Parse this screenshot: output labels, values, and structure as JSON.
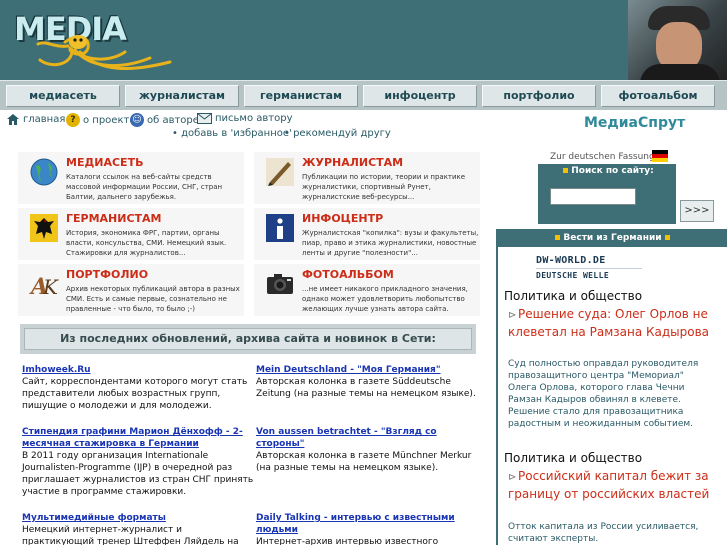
{
  "header": {
    "logo": "MEDIA"
  },
  "nav": [
    "медиасеть",
    "журналистам",
    "германистам",
    "инфоцентр",
    "портфолио",
    "фотоальбом"
  ],
  "toplinks": {
    "home": "главная",
    "about_project": "о проекте",
    "about_author": "об авторе",
    "letter": "письмо автору",
    "favorites": "• добавь в 'избранное'",
    "recommend": "• рекомендуй другу"
  },
  "site_title": "МедиаСпрут",
  "sections": [
    {
      "title": "МЕДИАСЕТЬ",
      "text": "Каталоги ссылок на веб-сайты средств массовой информации России, СНГ, стран Балтии, дальнего зарубежья.",
      "icon": "globe-icon"
    },
    {
      "title": "ЖУРНАЛИСТАМ",
      "text": "Публикации по истории, теории и практике журналистики, спортивный Рунет, журналистские веб-ресурсы...",
      "icon": "pen-icon"
    },
    {
      "title": "ГЕРМАНИСТАМ",
      "text": "История, экономика ФРГ, партии, органы власти, консульства, СМИ. Немецкий язык. Стажировки для журналистов...",
      "icon": "eagle-icon"
    },
    {
      "title": "ИНФОЦЕНТР",
      "text": "Журналистская \"копилка\": вузы и факультеты, пиар, право и этика журналистики, новостные ленты и другие \"полезности\"...",
      "icon": "info-icon"
    },
    {
      "title": "ПОРТФОЛИО",
      "text": "Архив некоторых публикаций автора в разных СМИ. Есть и самые первые, сознательно не правленные - что было, то было ;-)",
      "icon": "ak-monogram-icon"
    },
    {
      "title": "ФОТОАЛЬБОМ",
      "text": "...не имеет никакого прикладного значения, однако может удовлетворить любопытство желающих лучше узнать автора сайта.",
      "icon": "camera-icon"
    }
  ],
  "updates_header": "Из последних обновлений, архива сайта и новинок в Сети:",
  "news_left": [
    {
      "title": "Imhoweek.Ru",
      "text": "Сайт, корреспондентами которого могут стать представители любых возрастных групп, пишущие о молодежи и для молодежи."
    },
    {
      "title": "Стипендия графини Марион Дёнхофф - 2-месячная стажировка в Германии",
      "text": "В 2011 году организация Internationale Journalisten-Programme (IJP) в очередной раз приглашает журналистов из стран СНГ принять участие в программе стажировки."
    },
    {
      "title": "Мультимедийные форматы",
      "text": "Немецкий интернет-журналист и практикующий тренер Штеффен Ляйдель на примерах из мира СМИ"
    }
  ],
  "news_right": [
    {
      "title": "Mein Deutschland - \"Моя Германия\"",
      "text": "Авторская колонка в газете Süddeutsche Zeitung (на разные темы на немецком языке)."
    },
    {
      "title": "Von aussen betrachtet - \"Взгляд со стороны\"",
      "text": "Авторская колонка в газете Münchner Merkur (на разные темы на немецком языке)."
    },
    {
      "title": "Daily Talking - интервью с известными людьми",
      "text": "Интернет-архив интервью известного российского журналиста Андрея Морозова."
    }
  ],
  "right": {
    "lang_link": "Zur deutschen Fassung",
    "search_label": "Поиск по сайту:",
    "search_value": "",
    "search_button": ">>>",
    "dw_header": "Вести из Германии",
    "dw_logo_line1": "DW-WORLD.DE",
    "dw_logo_line2": "DEUTSCHE WELLE",
    "sections": [
      {
        "title": "Политика и общество",
        "item": "Решение суда: Олег Орлов не клеветал на Рамзана Кадырова",
        "desc": "Суд полностью оправдал руководителя правозащитного центра \"Мемориал\" Олега Орлова, которого глава Чечни Рамзан Кадыров обвинял в клевете. Решение стало для правозащитника радостным и неожиданным событием."
      },
      {
        "title": "Политика и общество",
        "item": "Российский капитал бежит за границу от российских властей",
        "desc": "Отток капитала из России усиливается, считают эксперты."
      }
    ]
  },
  "colors": {
    "header_bg": "#3e6e76",
    "accent_red": "#cc2d18",
    "link_blue": "#1a35b4",
    "title_teal": "#2f8a9a"
  }
}
